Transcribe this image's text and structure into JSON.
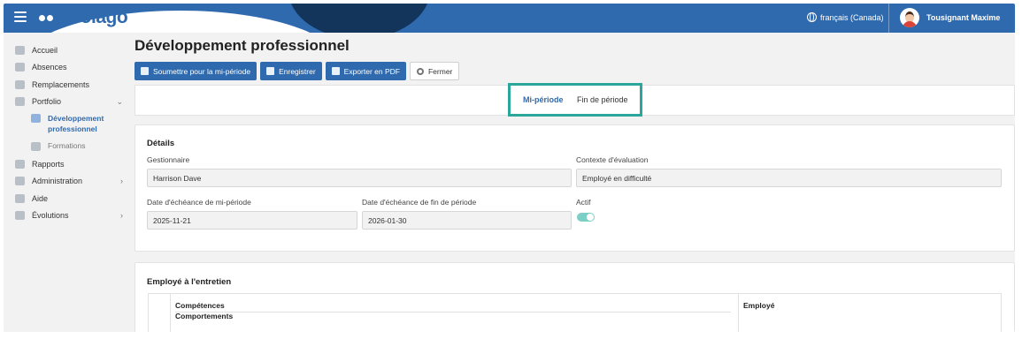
{
  "header": {
    "logo_text": "Scolago",
    "language": "français (Canada)",
    "user_name": "Tousignant Maxime"
  },
  "sidebar": {
    "items": [
      {
        "label": "Accueil",
        "icon": "home-icon"
      },
      {
        "label": "Absences",
        "icon": "person-icon"
      },
      {
        "label": "Remplacements",
        "icon": "swap-icon"
      },
      {
        "label": "Portfolio",
        "icon": "trophy-icon",
        "expanded": true
      },
      {
        "label": "Développement professionnel",
        "icon": "certificate-icon",
        "active": true
      },
      {
        "label": "Formations",
        "icon": "graduation-cap-icon"
      },
      {
        "label": "Rapports",
        "icon": "document-icon"
      },
      {
        "label": "Administration",
        "icon": "gear-icon"
      },
      {
        "label": "Aide",
        "icon": "question-icon"
      },
      {
        "label": "Évolutions",
        "icon": "sprout-icon"
      }
    ],
    "sub_line1": "Développement",
    "sub_line2": "professionnel"
  },
  "page": {
    "title": "Développement professionnel"
  },
  "toolbar": {
    "submit_label": "Soumettre pour la mi-période",
    "save_label": "Enregistrer",
    "export_label": "Exporter en PDF",
    "close_label": "Fermer"
  },
  "tabs": {
    "mid": "Mi-période",
    "end": "Fin de période",
    "active": "Mi-période"
  },
  "details": {
    "heading": "Détails",
    "manager_label": "Gestionnaire",
    "manager_value": "Harrison Dave",
    "context_label": "Contexte d'évaluation",
    "context_value": "Employé en difficulté",
    "mid_date_label": "Date d'échéance de mi-période",
    "mid_date_value": "2025-11-21",
    "end_date_label": "Date d'échéance de fin de période",
    "end_date_value": "2026-01-30",
    "active_label": "Actif",
    "active_value": true
  },
  "interview": {
    "heading": "Employé à l'entretien",
    "col_competences": "Compétences",
    "col_comportements": "Comportements",
    "col_employe": "Employé"
  },
  "colors": {
    "brand_blue": "#2f6aae",
    "highlight_teal": "#2aa69a",
    "toggle_on": "#7ccfc4"
  }
}
